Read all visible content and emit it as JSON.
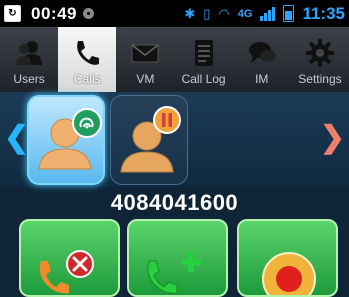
{
  "status_bar": {
    "time": "00:49",
    "network": "4G",
    "clock": "11:35"
  },
  "tabs": [
    {
      "label": "Users",
      "icon": "users-icon",
      "active": false
    },
    {
      "label": "Calls",
      "icon": "phone-icon",
      "active": true
    },
    {
      "label": "VM",
      "icon": "voicemail-icon",
      "active": false
    },
    {
      "label": "Call Log",
      "icon": "call-log-icon",
      "active": false
    },
    {
      "label": "IM",
      "icon": "chat-icon",
      "active": false
    },
    {
      "label": "Settings",
      "icon": "gear-icon",
      "active": false
    }
  ],
  "calls": {
    "cards": [
      {
        "icon": "caller-active-icon",
        "state": "active"
      },
      {
        "icon": "caller-hold-icon",
        "state": "hold"
      }
    ],
    "number": "4084041600"
  },
  "actions": [
    {
      "name": "end-call-button",
      "icon": "end-call-icon"
    },
    {
      "name": "add-call-button",
      "icon": "add-call-icon"
    },
    {
      "name": "record-button",
      "icon": "record-icon"
    }
  ],
  "colors": {
    "accent": "#2fa4ff",
    "green_button": "#3dbb52",
    "nav_right": "#f07f6a"
  }
}
